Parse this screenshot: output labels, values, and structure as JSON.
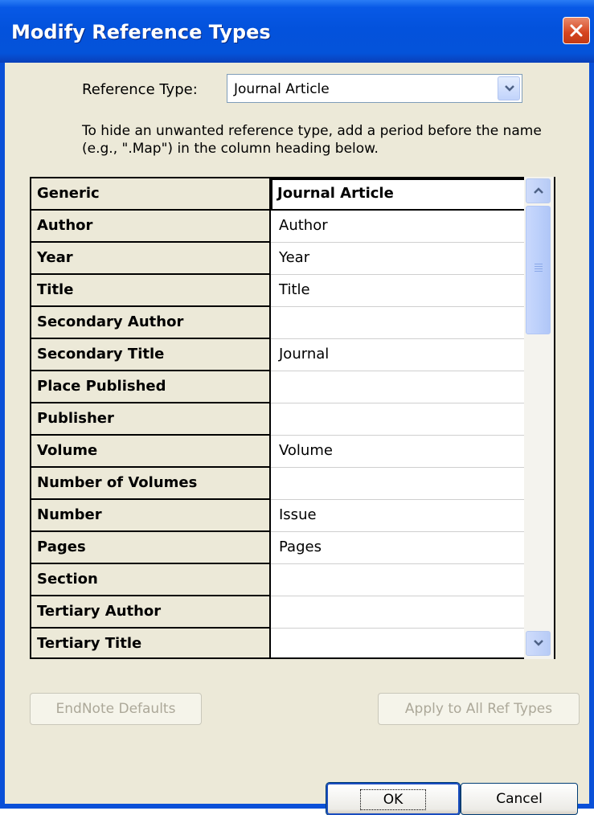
{
  "window": {
    "title": "Modify Reference Types",
    "close_icon": "close-icon"
  },
  "reference_type": {
    "label": "Reference Type:",
    "value": "Journal Article"
  },
  "info_text": "To hide an unwanted reference type, add a period before the name (e.g., \".Map\") in the column heading below.",
  "rows": [
    {
      "field": "Generic",
      "value": "Journal Article"
    },
    {
      "field": "Author",
      "value": "Author"
    },
    {
      "field": "Year",
      "value": "Year"
    },
    {
      "field": "Title",
      "value": "Title"
    },
    {
      "field": "Secondary Author",
      "value": ""
    },
    {
      "field": "Secondary Title",
      "value": "Journal"
    },
    {
      "field": "Place Published",
      "value": ""
    },
    {
      "field": "Publisher",
      "value": ""
    },
    {
      "field": "Volume",
      "value": "Volume"
    },
    {
      "field": "Number of Volumes",
      "value": ""
    },
    {
      "field": "Number",
      "value": "Issue"
    },
    {
      "field": "Pages",
      "value": "Pages"
    },
    {
      "field": "Section",
      "value": ""
    },
    {
      "field": "Tertiary Author",
      "value": ""
    },
    {
      "field": "Tertiary Title",
      "value": ""
    }
  ],
  "buttons": {
    "endnote_defaults": "EndNote Defaults",
    "apply_all": "Apply to All Ref Types",
    "ok": "OK",
    "cancel": "Cancel"
  }
}
